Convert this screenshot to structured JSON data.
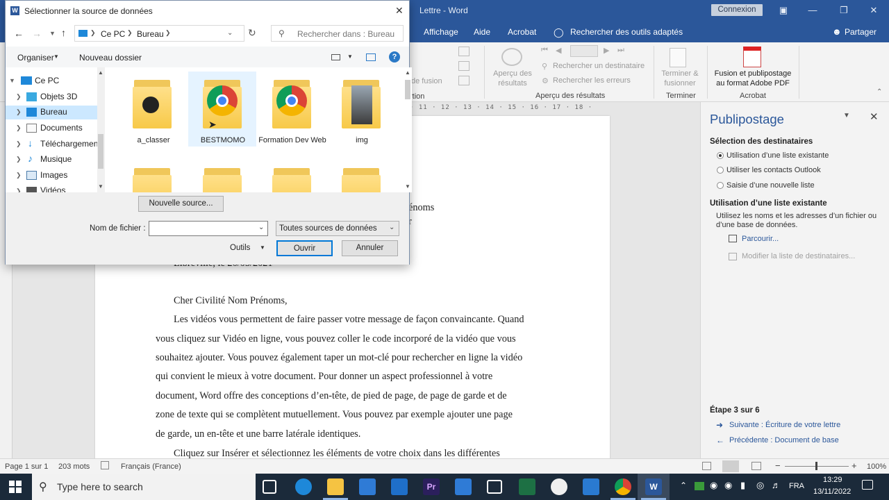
{
  "word": {
    "title": "Lettre - Word",
    "connexion": "Connexion",
    "share": "Partager",
    "tabs": [
      "Affichage",
      "Aide",
      "Acrobat"
    ],
    "search_tools": "Rechercher des outils adaptés"
  },
  "ribbon": {
    "de_fusion": "de fusion",
    "rtion": "rtion",
    "apercu_resultats_btn": "Aperçu des\nrésultats",
    "rechercher_destinataire": "Rechercher un destinataire",
    "rechercher_erreurs": "Rechercher les erreurs",
    "group_apercu": "Aperçu des résultats",
    "terminer_btn": "Terminer &\nfusionner",
    "group_terminer": "Terminer",
    "fusion_pdf": "Fusion et publipostage\nau format Adobe PDF",
    "group_acrobat": "Acrobat"
  },
  "ruler": "· 11 · 12 · 13 · 14 · 15 · 16 · 17 · 18 ·",
  "document": {
    "partial_1": "énoms",
    "partial_2": "r",
    "date_line": "Libreville, le 26/05/2021",
    "salutation": "Cher Civilité Nom Prénoms,",
    "paragraph_lines": [
      "Les vidéos vous permettent de faire passer votre message de façon convaincante. Quand",
      "vous cliquez sur Vidéo en ligne, vous pouvez coller le code incorporé de la vidéo que vous",
      "souhaitez ajouter. Vous pouvez également taper un mot-clé pour rechercher en ligne la vidéo",
      "qui convient le mieux à votre document. Pour donner un aspect professionnel à votre",
      "document, Word offre des conceptions d’en-tête, de pied de page, de page de garde et de",
      "zone de texte qui se complètent mutuellement. Vous pouvez par exemple ajouter une page",
      "de garde, un en-tête et une barre latérale identiques."
    ],
    "last_line": "Cliquez sur Insérer et sélectionnez les éléments de votre choix dans les différentes"
  },
  "pane": {
    "title": "Publipostage",
    "sel_heading": "Sélection des destinataires",
    "options": [
      "Utilisation d’une liste existante",
      "Utiliser les contacts Outlook",
      "Saisie d’une nouvelle liste"
    ],
    "selected_option": 0,
    "use_heading": "Utilisation d’une liste existante",
    "use_desc": "Utilisez les noms et les adresses d’un fichier ou d’une base de données.",
    "browse": "Parcourir...",
    "modify": "Modifier la liste de destinataires...",
    "step": "Étape 3 sur 6",
    "next": "Suivante : Écriture de votre lettre",
    "prev": "Précédente : Document de base"
  },
  "status": {
    "page": "Page 1 sur 1",
    "words": "203 mots",
    "language": "Français (France)",
    "zoom": "100%"
  },
  "taskbar": {
    "search_placeholder": "Type here to search",
    "lang": "FRA",
    "time": "13:29",
    "date": "13/11/2022"
  },
  "dialog": {
    "title": "Sélectionner la source de données",
    "breadcrumb": [
      "Ce PC",
      "Bureau"
    ],
    "search_placeholder": "Rechercher dans : Bureau",
    "organize": "Organiser",
    "new_folder": "Nouveau dossier",
    "nav_items": [
      "Ce PC",
      "Objets 3D",
      "Bureau",
      "Documents",
      "Téléchargements",
      "Musique",
      "Images",
      "Vidéos"
    ],
    "selected_nav": "Bureau",
    "files": [
      "a_classer",
      "BESTMOMO",
      "Formation Dev Web",
      "img"
    ],
    "new_source": "Nouvelle source...",
    "filename_label": "Nom de fichier :",
    "filename_value": "",
    "filetype": "Toutes sources de données",
    "tools": "Outils",
    "open": "Ouvrir",
    "cancel": "Annuler"
  }
}
